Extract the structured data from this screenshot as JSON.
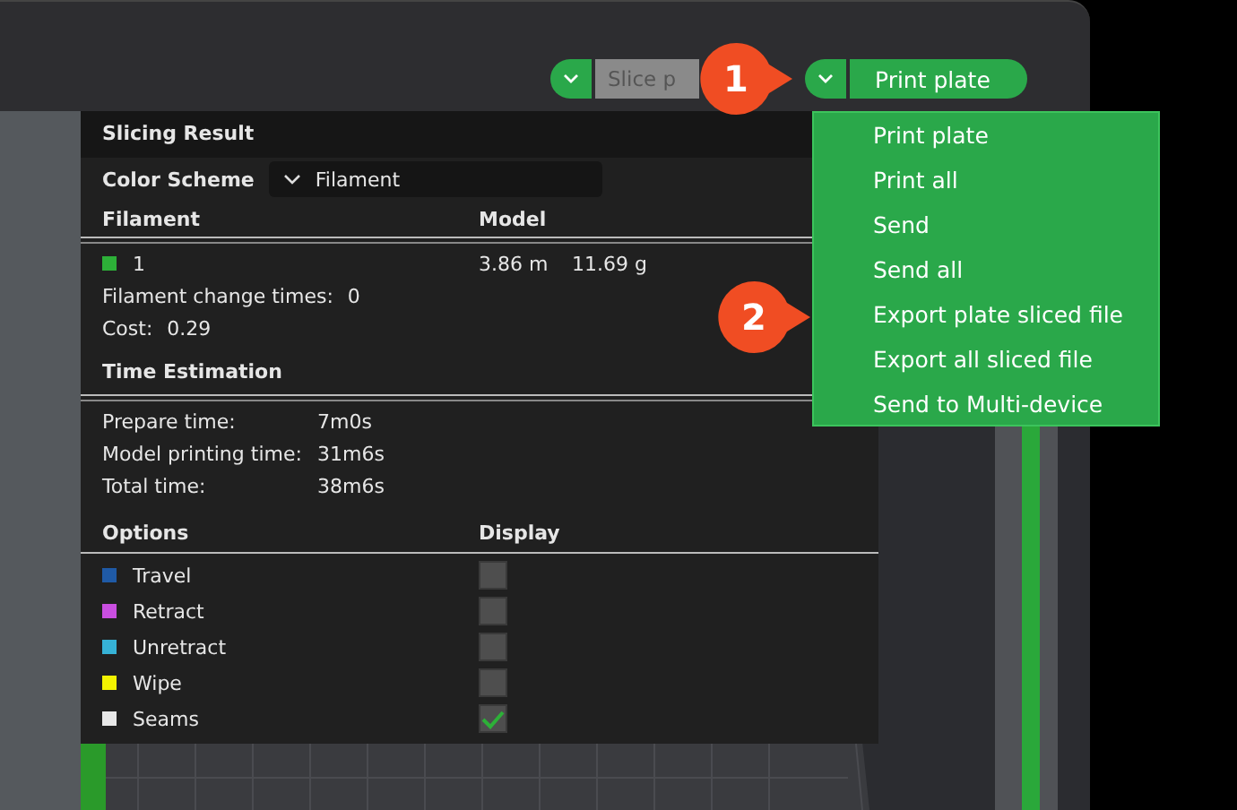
{
  "toolbar": {
    "slice_button": {
      "label": "Slice p"
    },
    "print_button": {
      "label": "Print plate"
    }
  },
  "print_menu": {
    "items": [
      {
        "label": "Print plate"
      },
      {
        "label": "Print all"
      },
      {
        "label": "Send"
      },
      {
        "label": "Send all"
      },
      {
        "label": "Export plate sliced file"
      },
      {
        "label": "Export all sliced file"
      },
      {
        "label": "Send to Multi-device"
      }
    ]
  },
  "callouts": [
    {
      "label": "1"
    },
    {
      "label": "2"
    }
  ],
  "slicing_result": {
    "title": "Slicing Result",
    "color_scheme": {
      "label": "Color Scheme",
      "value": "Filament"
    },
    "filament_header": {
      "column_1": "Filament",
      "column_2": "Model"
    },
    "filaments": [
      {
        "name": "1",
        "color": "#2db038",
        "length": "3.86 m",
        "weight": "11.69 g"
      }
    ],
    "change_times": {
      "label": "Filament change times:",
      "value": "0"
    },
    "cost": {
      "label": "Cost:",
      "value": "0.29"
    },
    "time_title": "Time Estimation",
    "times": [
      {
        "label": "Prepare time:",
        "value": "7m0s"
      },
      {
        "label": "Model printing time:",
        "value": "31m6s"
      },
      {
        "label": "Total time:",
        "value": "38m6s"
      }
    ],
    "options_header": {
      "column_1": "Options",
      "column_2": "Display"
    },
    "options": [
      {
        "label": "Travel",
        "color": "#1f5aa6",
        "checked": false
      },
      {
        "label": "Retract",
        "color": "#c94ee0",
        "checked": false
      },
      {
        "label": "Unretract",
        "color": "#36b2d6",
        "checked": false
      },
      {
        "label": "Wipe",
        "color": "#f2f200",
        "checked": false
      },
      {
        "label": "Seams",
        "color": "#e8e8e8",
        "checked": true
      }
    ]
  }
}
